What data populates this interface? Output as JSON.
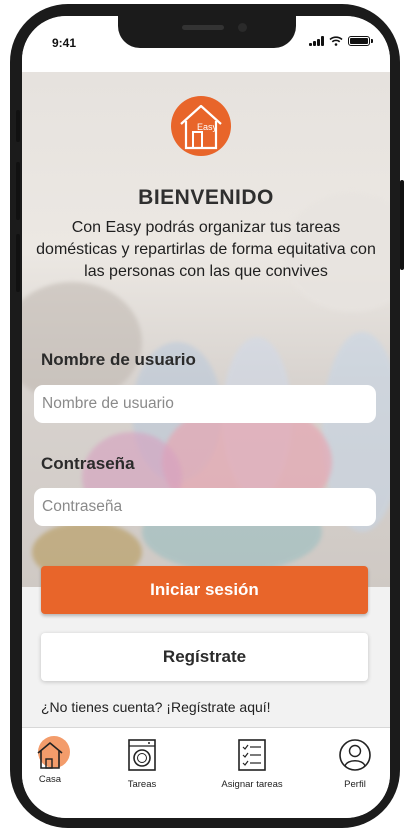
{
  "status_bar": {
    "time": "9:41"
  },
  "logo": {
    "text": "Easy"
  },
  "header": {
    "title": "BIENVENIDO",
    "intro": "Con Easy podrás organizar tus tareas domésticas y repartirlas de forma equitativa con las personas con las que convives"
  },
  "form": {
    "username_label": "Nombre de usuario",
    "username_placeholder": "Nombre de usuario",
    "password_label": "Contraseña",
    "password_placeholder": "Contraseña",
    "login_button": "Iniciar sesión",
    "register_button": "Regístrate",
    "register_link": "¿No tienes cuenta? ¡Regístrate aquí!"
  },
  "tabbar": {
    "items": [
      {
        "label": "Casa",
        "icon": "house-icon",
        "active": true
      },
      {
        "label": "Tareas",
        "icon": "washing-machine-icon",
        "active": false
      },
      {
        "label": "Asignar tareas",
        "icon": "checklist-icon",
        "active": false
      },
      {
        "label": "Perfil",
        "icon": "user-icon",
        "active": false
      }
    ]
  },
  "colors": {
    "accent": "#e8652a",
    "accent_light": "#f39c6b"
  }
}
